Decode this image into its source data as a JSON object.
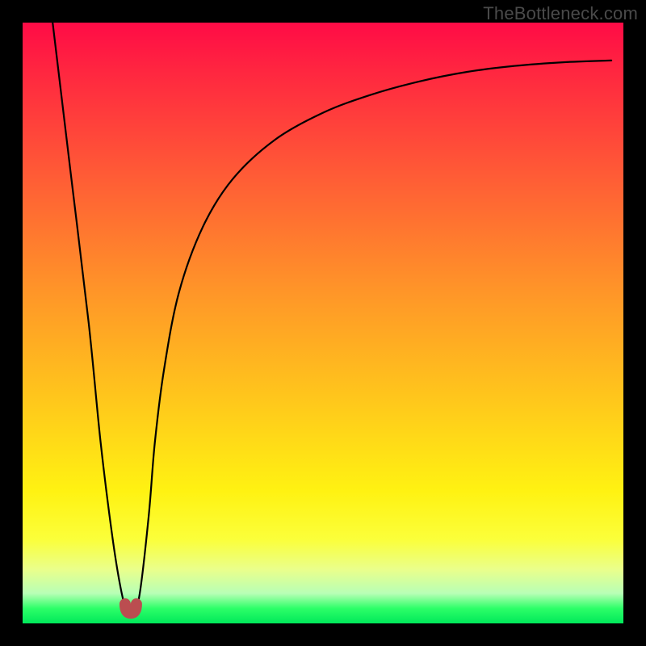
{
  "watermark": "TheBottleneck.com",
  "chart_data": {
    "type": "line",
    "title": "",
    "xlabel": "",
    "ylabel": "",
    "xlim": [
      0,
      100
    ],
    "ylim": [
      0,
      100
    ],
    "series": [
      {
        "name": "bottleneck-curve",
        "x": [
          5,
          8,
          11,
          13,
          15,
          16.5,
          17.5,
          18.5,
          19.5,
          21,
          22,
          23.5,
          26,
          30,
          35,
          42,
          50,
          58,
          66,
          74,
          82,
          90,
          98
        ],
        "values": [
          100,
          75,
          50,
          30,
          14,
          5,
          2,
          2,
          5,
          18,
          30,
          42,
          55,
          66,
          74,
          80.5,
          85,
          88,
          90.2,
          91.8,
          92.8,
          93.4,
          93.7
        ]
      }
    ],
    "marker": {
      "name": "minimum-marker",
      "x": 18,
      "value": 2,
      "color": "#bb4d50"
    },
    "gradient_stops": [
      {
        "pos": 0,
        "color": "#ff0b46"
      },
      {
        "pos": 0.45,
        "color": "#ff9628"
      },
      {
        "pos": 0.78,
        "color": "#fff212"
      },
      {
        "pos": 1.0,
        "color": "#00e85a"
      }
    ]
  }
}
